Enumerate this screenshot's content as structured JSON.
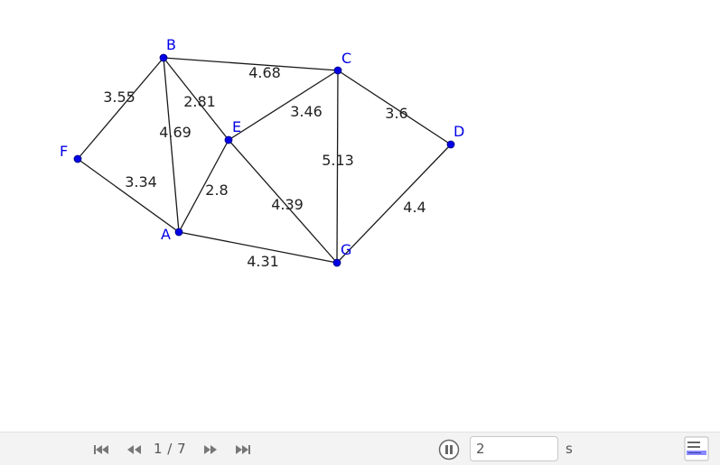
{
  "graph": {
    "vertices": [
      {
        "id": "B",
        "label": "B"
      },
      {
        "id": "C",
        "label": "C"
      },
      {
        "id": "F",
        "label": "F"
      },
      {
        "id": "E",
        "label": "E"
      },
      {
        "id": "D",
        "label": "D"
      },
      {
        "id": "A",
        "label": "A"
      },
      {
        "id": "G",
        "label": "G"
      }
    ],
    "edges": [
      {
        "from": "B",
        "to": "C",
        "weight": "4.68"
      },
      {
        "from": "B",
        "to": "F",
        "weight": "3.55"
      },
      {
        "from": "B",
        "to": "E",
        "weight": "2.81"
      },
      {
        "from": "B",
        "to": "A",
        "weight": "4.69"
      },
      {
        "from": "F",
        "to": "A",
        "weight": "3.34"
      },
      {
        "from": "E",
        "to": "C",
        "weight": "3.46"
      },
      {
        "from": "C",
        "to": "D",
        "weight": "3.6"
      },
      {
        "from": "C",
        "to": "G",
        "weight": "5.13"
      },
      {
        "from": "E",
        "to": "A",
        "weight": "2.8"
      },
      {
        "from": "E",
        "to": "G",
        "weight": "4.39"
      },
      {
        "from": "D",
        "to": "G",
        "weight": "4.4"
      },
      {
        "from": "A",
        "to": "G",
        "weight": "4.31"
      }
    ],
    "colors": {
      "vertex": "#0000e6",
      "edge": "#1a1a1a"
    }
  },
  "player": {
    "slide_counter": "1 / 7",
    "speed_value": "2",
    "speed_unit": "s",
    "buttons": {
      "first": "first-slide-icon",
      "prev": "previous-slide-icon",
      "next": "next-slide-icon",
      "last": "last-slide-icon",
      "pause": "pause-icon",
      "algebra": "algebra-view-icon"
    }
  }
}
